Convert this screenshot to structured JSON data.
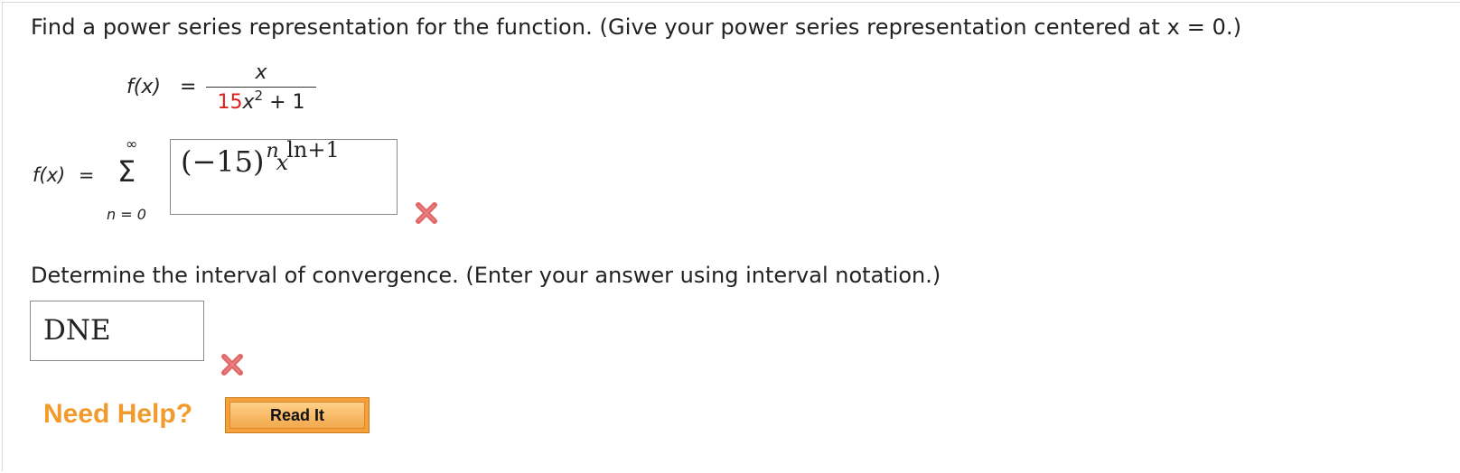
{
  "question1": {
    "prompt": "Find a power series representation for the function. (Give your power series representation centered at x = 0.)",
    "function_lhs": "f(x)",
    "equals": "=",
    "numerator": "x",
    "denominator_coeff": "15",
    "denominator_var": "x",
    "denominator_exp": "2",
    "denominator_rest": " + 1",
    "sum_lhs": "f(x)",
    "sum_equals": "=",
    "sum_upper": "∞",
    "sum_symbol": "Σ",
    "sum_lower": "n = 0",
    "answer": {
      "base": "(−15)",
      "exp_n": "n",
      "var": "x",
      "exp_rest": "ln+1"
    },
    "status_icon": "incorrect-x-icon"
  },
  "question2": {
    "prompt": "Determine the interval of convergence. (Enter your answer using interval notation.)",
    "answer": "DNE",
    "status_icon": "incorrect-x-icon"
  },
  "help": {
    "label": "Need Help?",
    "read_it_label": "Read It"
  },
  "colors": {
    "accent_red": "#e0201b",
    "help_orange": "#f39a2d",
    "button_orange": "#f5a03a",
    "error_red": "#e06666"
  }
}
